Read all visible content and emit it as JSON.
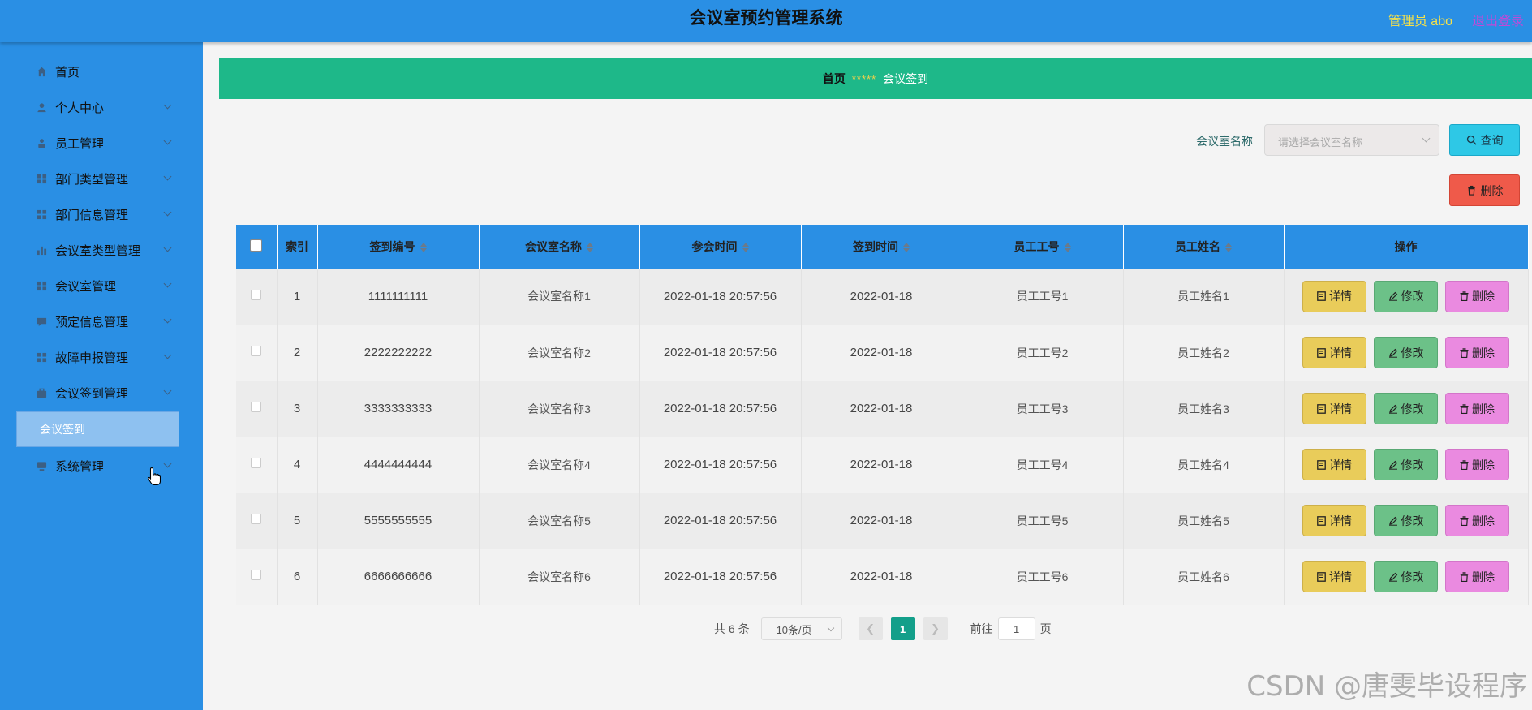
{
  "header": {
    "title": "会议室预约管理系统",
    "admin": "管理员 abo",
    "logout": "退出登录"
  },
  "sidebar": {
    "items": [
      {
        "label": "首页",
        "icon": "home-icon"
      },
      {
        "label": "个人中心",
        "icon": "user-icon"
      },
      {
        "label": "员工管理",
        "icon": "user-icon"
      },
      {
        "label": "部门类型管理",
        "icon": "grid-icon"
      },
      {
        "label": "部门信息管理",
        "icon": "grid-icon"
      },
      {
        "label": "会议室类型管理",
        "icon": "bar-chart-icon"
      },
      {
        "label": "会议室管理",
        "icon": "grid-icon"
      },
      {
        "label": "预定信息管理",
        "icon": "message-icon"
      },
      {
        "label": "故障申报管理",
        "icon": "grid-icon"
      },
      {
        "label": "会议签到管理",
        "icon": "briefcase-icon"
      },
      {
        "label": "系统管理",
        "icon": "monitor-icon"
      }
    ],
    "sub_item": "会议签到"
  },
  "breadcrumb": {
    "home": "首页",
    "separator": "*****",
    "current": "会议签到"
  },
  "search": {
    "label": "会议室名称",
    "placeholder": "请选择会议室名称",
    "query_button": "查询",
    "delete_button": "删除"
  },
  "table": {
    "headers": [
      "索引",
      "签到编号",
      "会议室名称",
      "参会时间",
      "签到时间",
      "员工工号",
      "员工姓名",
      "操作"
    ],
    "rows": [
      {
        "index": "1",
        "code": "1111111111",
        "room": "会议室名称1",
        "meeting_time": "2022-01-18 20:57:56",
        "sign_time": "2022-01-18",
        "emp_no": "员工工号1",
        "emp_name": "员工姓名1"
      },
      {
        "index": "2",
        "code": "2222222222",
        "room": "会议室名称2",
        "meeting_time": "2022-01-18 20:57:56",
        "sign_time": "2022-01-18",
        "emp_no": "员工工号2",
        "emp_name": "员工姓名2"
      },
      {
        "index": "3",
        "code": "3333333333",
        "room": "会议室名称3",
        "meeting_time": "2022-01-18 20:57:56",
        "sign_time": "2022-01-18",
        "emp_no": "员工工号3",
        "emp_name": "员工姓名3"
      },
      {
        "index": "4",
        "code": "4444444444",
        "room": "会议室名称4",
        "meeting_time": "2022-01-18 20:57:56",
        "sign_time": "2022-01-18",
        "emp_no": "员工工号4",
        "emp_name": "员工姓名4"
      },
      {
        "index": "5",
        "code": "5555555555",
        "room": "会议室名称5",
        "meeting_time": "2022-01-18 20:57:56",
        "sign_time": "2022-01-18",
        "emp_no": "员工工号5",
        "emp_name": "员工姓名5"
      },
      {
        "index": "6",
        "code": "6666666666",
        "room": "会议室名称6",
        "meeting_time": "2022-01-18 20:57:56",
        "sign_time": "2022-01-18",
        "emp_no": "员工工号6",
        "emp_name": "员工姓名6"
      }
    ],
    "actions": {
      "detail": "详情",
      "edit": "修改",
      "delete": "删除"
    }
  },
  "pagination": {
    "total": "共 6 条",
    "page_size": "10条/页",
    "current_page": "1",
    "goto_prefix": "前往",
    "goto_value": "1",
    "goto_suffix": "页"
  },
  "watermark": "CSDN @唐雯毕设程序",
  "colors": {
    "header": "#2a8fe4",
    "breadcrumb": "#1eb889",
    "query": "#2ec8e6",
    "delete": "#ef5a4a",
    "detail": "#e9cc5a",
    "edit": "#6cc188",
    "remove": "#ea8ae0",
    "page_active": "#139f8a"
  }
}
